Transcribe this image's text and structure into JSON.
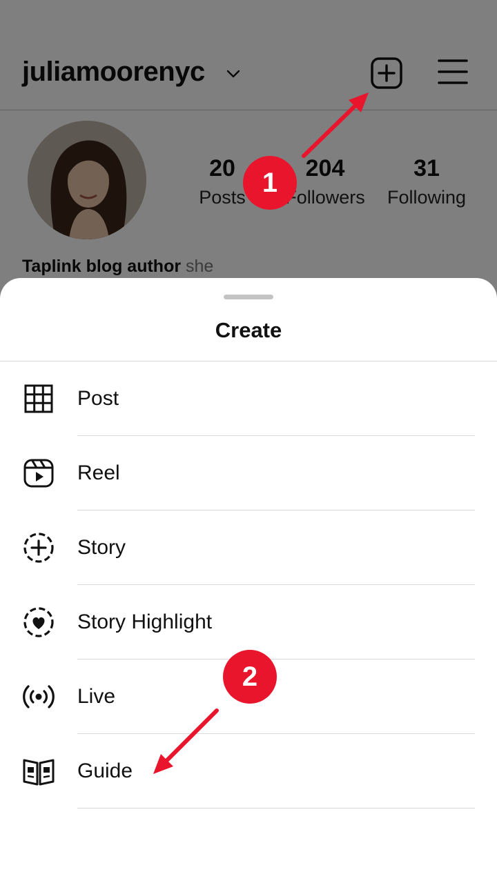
{
  "profile": {
    "username": "juliamoorenyc",
    "stats": [
      {
        "value": "20",
        "label": "Posts"
      },
      {
        "value": "204",
        "label": "Followers"
      },
      {
        "value": "31",
        "label": "Following"
      }
    ],
    "bio_name": "Taplink blog author",
    "bio_pronoun": "she"
  },
  "icons": {
    "username_dropdown": "chevron-down-icon",
    "create": "plus-square-icon",
    "menu": "hamburger-menu-icon"
  },
  "sheet": {
    "title": "Create",
    "items": [
      {
        "label": "Post",
        "icon": "grid-icon"
      },
      {
        "label": "Reel",
        "icon": "reel-icon"
      },
      {
        "label": "Story",
        "icon": "story-add-icon"
      },
      {
        "label": "Story Highlight",
        "icon": "highlight-heart-icon"
      },
      {
        "label": "Live",
        "icon": "live-broadcast-icon"
      },
      {
        "label": "Guide",
        "icon": "guide-book-icon"
      }
    ]
  },
  "annotations": {
    "step1": "1",
    "step2": "2",
    "accent_color": "#e8152c"
  }
}
